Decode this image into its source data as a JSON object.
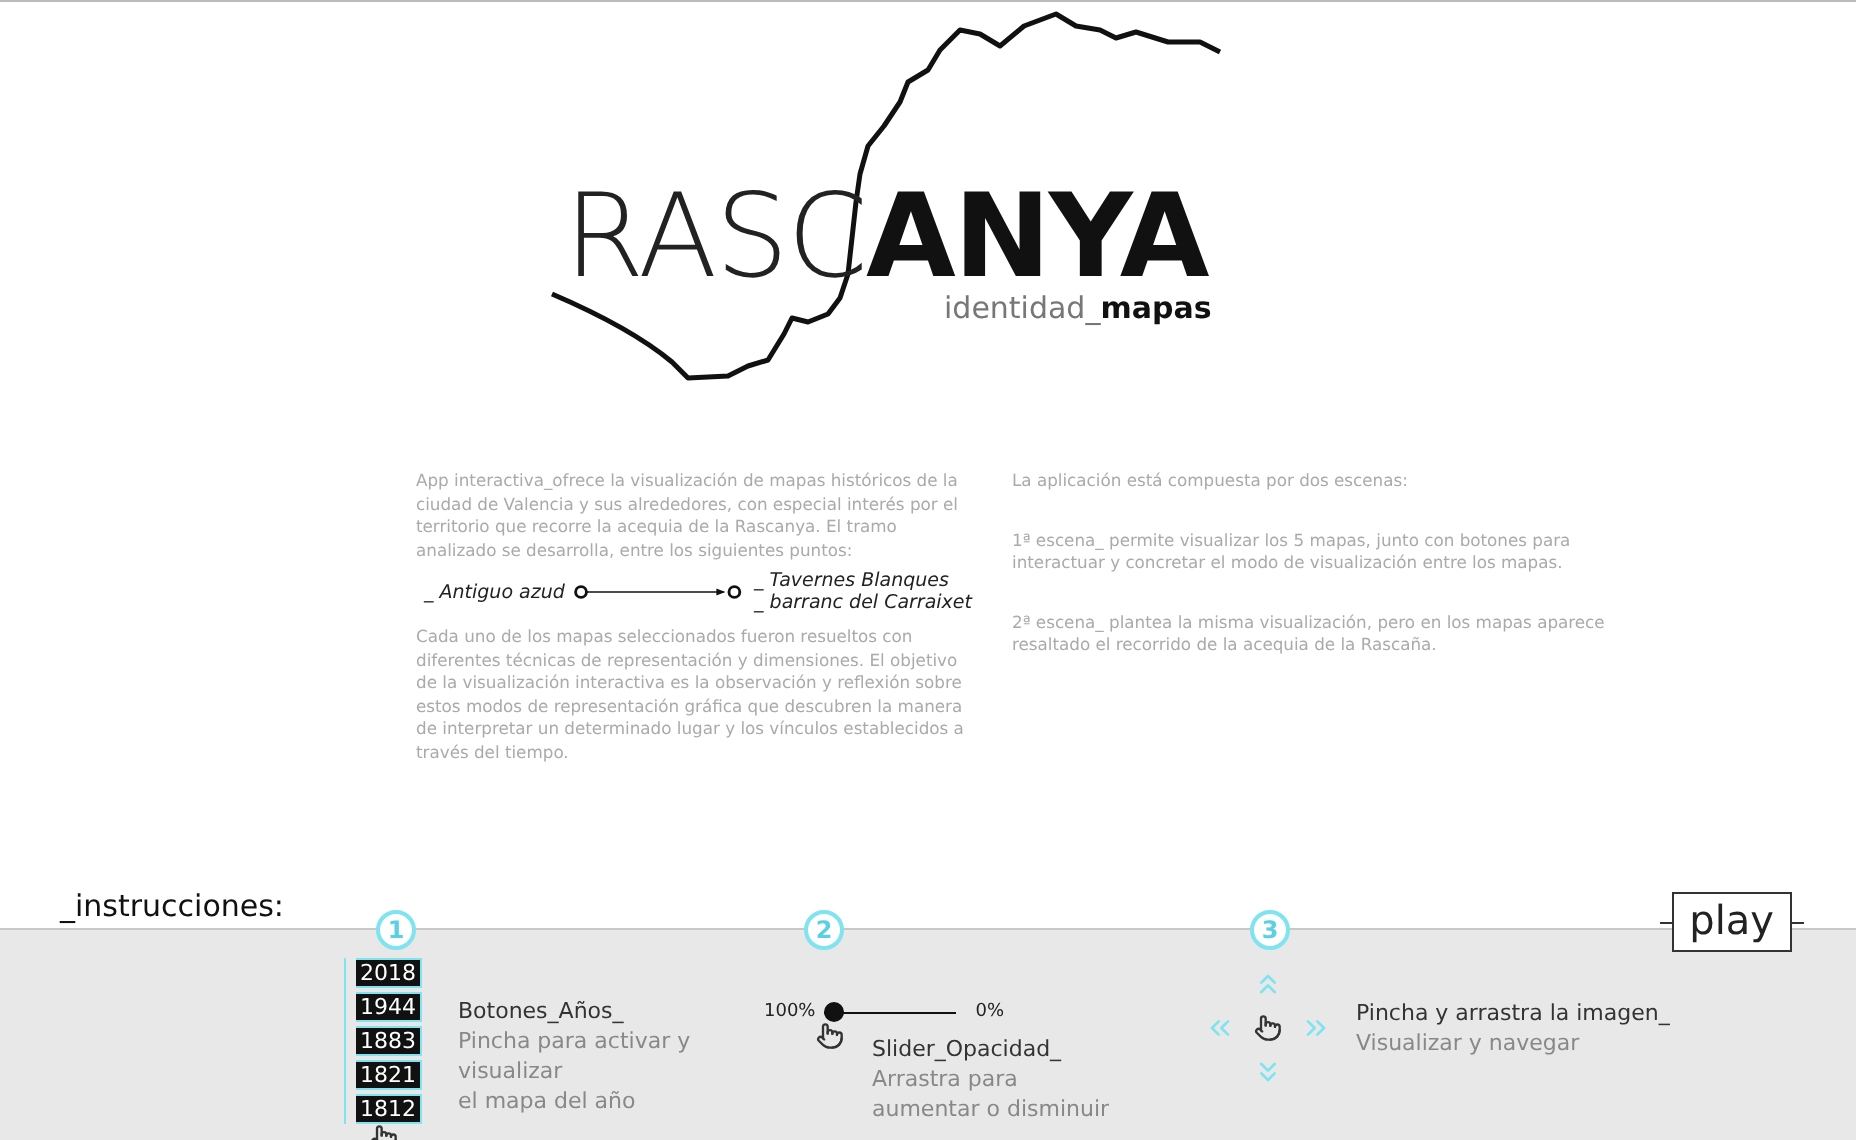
{
  "logo": {
    "title": "RASC**ANYA**",
    "subtitle": "identidad_**mapas**"
  },
  "intro": {
    "paragraph_1": "App interactiva_ofrece la visualización de mapas históricos de la ciudad de Valencia y sus alrededores, con especial interés por el territorio que recorre la acequia de la Rascanya. El tramo analizado se desarrolla, entre los siguientes puntos:",
    "route": {
      "start": "_ Antiguo azud",
      "end": [
        "_ Tavernes Blanques",
        "_ barranc del Carraixet"
      ]
    },
    "paragraph_2": "Cada uno de los mapas seleccionados fueron resueltos con diferentes técnicas de representación y dimensiones. El objetivo de la visualización interactiva es la observación y reflexión sobre estos modos de representación gráfica que descubren la manera de interpretar un determinado lugar y los vínculos establecidos a través del tiempo."
  },
  "scenes": [
    "La aplicación está compuesta por dos escenas:",
    "1ª escena_ permite visualizar los 5 mapas, junto con botones para interactuar y concretar el modo de visualización entre los mapas.",
    "2ª escena_ plantea la misma visualización, pero en los mapas aparece resaltado el recorrido de la acequia de la Rascaña."
  ],
  "instructions": {
    "title": "_instrucciones:",
    "play_button": "play",
    "steps": [
      {
        "number": "1",
        "kind": "years",
        "years": [
          "2018",
          "1944",
          "1883",
          "1821",
          "1812"
        ],
        "title": "Botones_Años_",
        "description": [
          "Pincha para activar y",
          "visualizar",
          "el mapa del año"
        ]
      },
      {
        "number": "2",
        "kind": "slider",
        "start_label": "100%",
        "end_label": "0%",
        "level": 0,
        "title": "Slider_Opacidad_",
        "description": [
          "Arrastra para",
          "aumentar o disminuir"
        ]
      },
      {
        "number": "3",
        "kind": "drag",
        "title": "Pincha y arrastra la imagen_",
        "description": [
          "Visualizar y navegar"
        ]
      }
    ]
  }
}
